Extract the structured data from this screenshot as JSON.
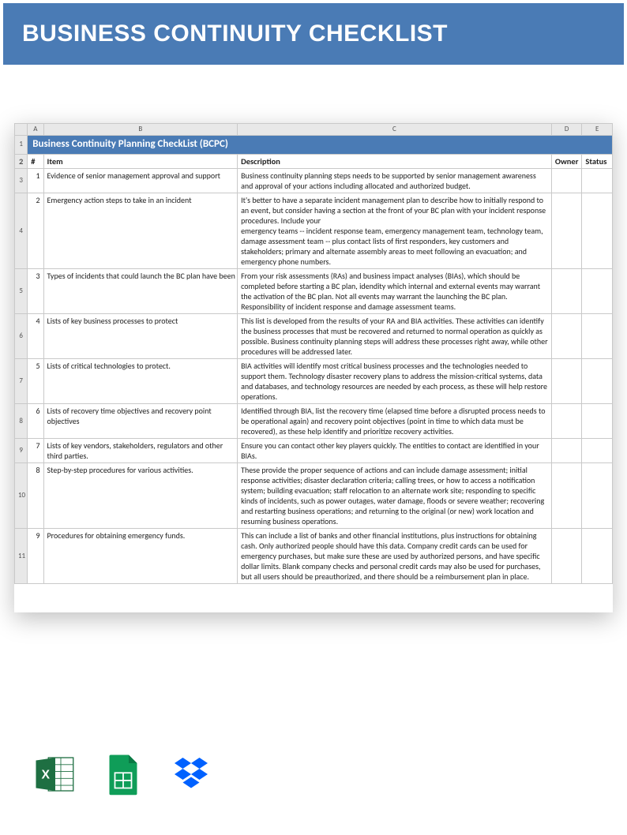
{
  "banner": {
    "title": "BUSINESS CONTINUITY CHECKLIST"
  },
  "sheet": {
    "title": "Business Continuity Planning CheckList (BCPC)",
    "col_headers": {
      "a": "A",
      "b": "B",
      "c": "C",
      "d": "D",
      "e": "E"
    },
    "headers": {
      "num": "#",
      "item": "Item",
      "desc": "Description",
      "owner": "Owner",
      "status": "Status"
    },
    "rows": [
      {
        "rnum": "3",
        "n": "1",
        "item": "Evidence of senior management approval and support",
        "desc": "Business continuity planning steps  needs to be supported by senior management awareness and approval of your actions including allocated and authorized budget."
      },
      {
        "rnum": "4",
        "n": "2",
        "item": "Emergency action steps to take in an incident",
        "desc": "It's better to have a separate incident management plan to describe how to initially respond to an event, but consider having a section at the front of your BC plan with your incident response procedures. Include your\nemergency teams -- incident response team, emergency management team, technology team, damage assessment team -- plus contact lists of first responders, key customers and stakeholders; primary and alternate assembly areas to meet following an evacuation; and emergency phone numbers."
      },
      {
        "rnum": "5",
        "n": "3",
        "item": "Types of incidents that could launch the BC plan have been clearly de",
        "desc": "From your risk assessments (RAs) and business impact analyses (BIAs), which should be completed before starting a BC plan, idendity which internal and external events may warrant the activation of the BC plan. Not all events may warrant the launching the BC plan. Responsibility of incident response and damage assessment teams."
      },
      {
        "rnum": "6",
        "n": "4",
        "item": "Lists of key business processes to protect",
        "desc": "This list is developed from the results of your RA and BIA activities. These activities can identify the business processes that must be recovered and returned to normal operation as quickly as possible. Business continuity planning steps will  address these processes right away, while other procedures will be addressed later."
      },
      {
        "rnum": "7",
        "n": "5",
        "item": "Lists of critical technologies to protect.",
        "desc": "BIA activities will identify most critical business processes and the technologies needed to support them. Technology disaster recovery plans to address the mission-critical systems, data and databases, and technology resources are needed by each process, as these will help restore operations."
      },
      {
        "rnum": "8",
        "n": "6",
        "item": "Lists of recovery time objectives and recovery point objectives",
        "desc": "Identified through BIA, list the recovery time (elapsed time before a disrupted process needs to be operational again) and recovery point objectives (point in time to which data must be recovered), as these help identify and prioritize recovery activities."
      },
      {
        "rnum": "9",
        "n": "7",
        "item": "Lists of key vendors, stakeholders, regulators and other third parties.",
        "desc": "Ensure you can contact other key players quickly. The entities to contact are identified in your BIAs."
      },
      {
        "rnum": "10",
        "n": "8",
        "item": "Step-by-step procedures for various activities.",
        "desc": "These provide the proper sequence of actions and can include damage assessment; initial response activities; disaster declaration criteria; calling trees, or how to access a notification system; building evacuation; staff relocation to an alternate work site; responding to specific kinds of incidents, such as power outages, water damage, floods or severe weather; recovering and restarting business operations; and returning to the original (or new) work location and resuming business operations."
      },
      {
        "rnum": "11",
        "n": "9",
        "item": "Procedures for obtaining emergency funds.",
        "desc": "This can include a list of banks and other financial institutions, plus instructions for obtaining cash. Only authorized people should have this data. Company credit cards can be used for emergency purchases, but make sure these are used by authorized persons, and have specific dollar limits. Blank company checks and personal credit cards may also be used for purchases, but all users should be preauthorized, and there should be a reimbursement plan in place."
      }
    ]
  },
  "icons": {
    "excel": "excel-icon",
    "sheets": "google-sheets-icon",
    "dropbox": "dropbox-icon"
  }
}
